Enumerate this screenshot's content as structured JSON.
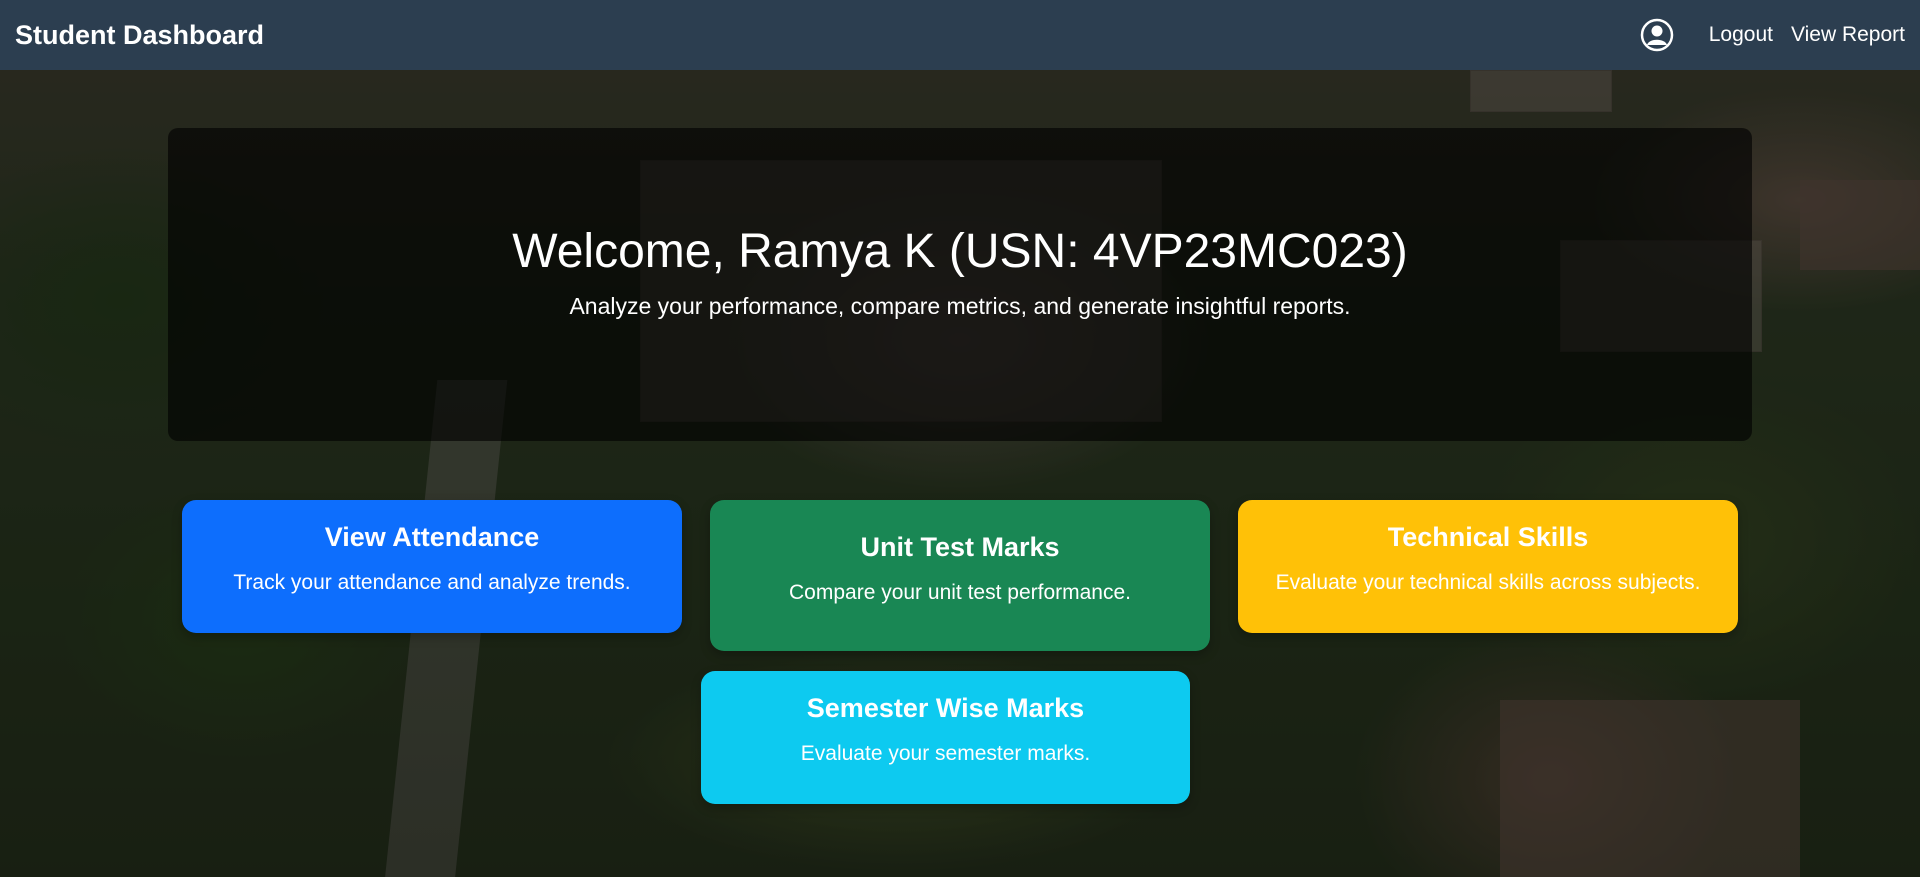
{
  "navbar": {
    "brand": "Student Dashboard",
    "user_icon": "user-circle-icon",
    "logout_label": "Logout",
    "view_report_label": "View Report",
    "background_color": "#2c3e50"
  },
  "welcome": {
    "title": "Welcome, Ramya K (USN: 4VP23MC023)",
    "subtitle": "Analyze your performance, compare metrics, and generate insightful reports."
  },
  "cards": [
    {
      "title": "View Attendance",
      "description": "Track your attendance and analyze trends.",
      "color": "#0d6efd"
    },
    {
      "title": "Unit Test Marks",
      "description": "Compare your unit test performance.",
      "color": "#198754"
    },
    {
      "title": "Technical Skills",
      "description": "Evaluate your technical skills across subjects.",
      "color": "#ffc107"
    },
    {
      "title": "Semester Wise Marks",
      "description": "Evaluate your semester marks.",
      "color": "#0dcaf0"
    }
  ]
}
